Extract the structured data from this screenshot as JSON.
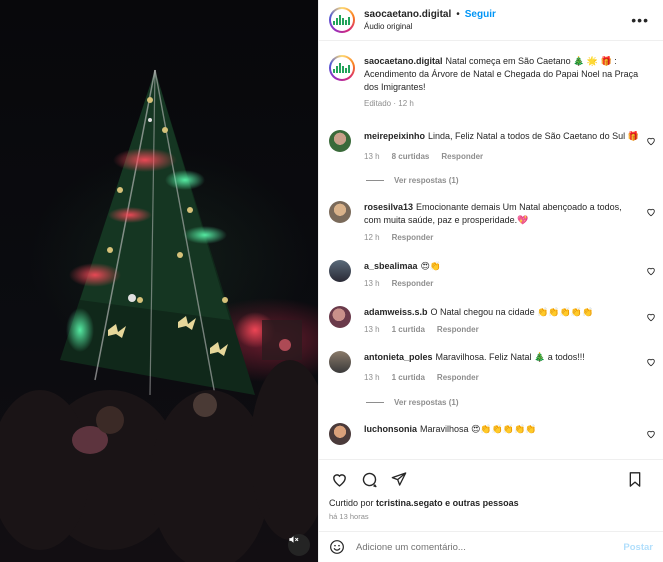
{
  "header": {
    "username": "saocaetano.digital",
    "separator": "•",
    "follow_label": "Seguir",
    "audio_label": "Áudio original",
    "more_icon": "ellipsis-icon"
  },
  "caption": {
    "username": "saocaetano.digital",
    "text": "Natal começa em São Caetano 🎄 🌟 🎁 : Acendimento da Árvore de Natal e Chegada do Papai Noel na Praça dos Imigrantes!",
    "edited": "Editado · 12 h"
  },
  "comments": [
    {
      "username": "meirepeixinho",
      "text": "Linda, Feliz Natal a todos de São Caetano do Sul 🎁",
      "time": "13 h",
      "likes": "8 curtidas",
      "reply_label": "Responder",
      "view_replies": "Ver respostas (1)"
    },
    {
      "username": "rosesilva13",
      "text": "Emocionante demais Um Natal abençoado a todos, com muita saúde, paz e prosperidade.💖",
      "time": "12 h",
      "reply_label": "Responder"
    },
    {
      "username": "a_sbealimaa",
      "text": "😍👏",
      "time": "13 h",
      "reply_label": "Responder"
    },
    {
      "username": "adamweiss.s.b",
      "text": "O Natal chegou na cidade 👏👏👏👏👏",
      "time": "13 h",
      "likes": "1 curtida",
      "reply_label": "Responder"
    },
    {
      "username": "antonieta_poles",
      "text": "Maravilhosa. Feliz Natal 🎄 a todos!!!",
      "time": "13 h",
      "likes": "1 curtida",
      "reply_label": "Responder",
      "view_replies": "Ver respostas (1)"
    },
    {
      "username": "luchonsonia",
      "text": "Maravilhosa 😍👏👏👏👏👏"
    }
  ],
  "footer": {
    "liked_prefix": "Curtido por",
    "liked_user": "tcristina.segato",
    "liked_suffix": "e outras pessoas",
    "ago": "há 13 horas",
    "comment_placeholder": "Adicione um comentário...",
    "post_label": "Postar"
  },
  "colors": {
    "accent": "#0095f6",
    "muted": "#8e8e8e",
    "post_disabled": "#b2dffc"
  }
}
